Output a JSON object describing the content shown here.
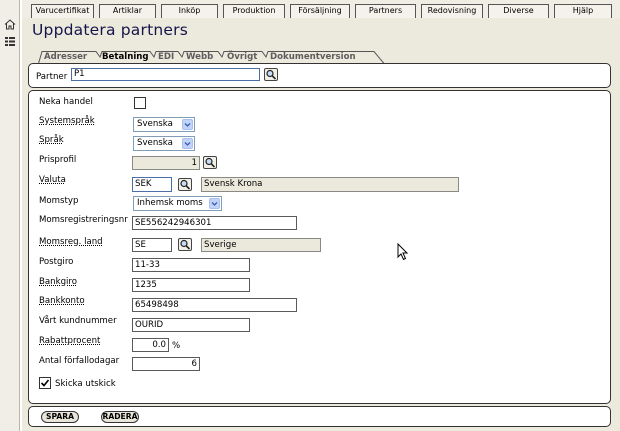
{
  "menu": {
    "items": [
      "Varucertifikat",
      "Artiklar",
      "Inköp",
      "Produktion",
      "Försäljning",
      "Partners",
      "Redovisning",
      "Diverse",
      "Hjälp"
    ]
  },
  "page": {
    "title": "Uppdatera partners"
  },
  "subtabs": {
    "items": [
      "Adresser",
      "Betalning",
      "EDI",
      "Webb",
      "Övrigt",
      "Dokumentversion"
    ],
    "active": "Betalning"
  },
  "partner": {
    "label": "Partner",
    "value": "P1"
  },
  "form": {
    "neka_handel": {
      "label": "Neka handel",
      "checked": false
    },
    "systemsprak": {
      "label": "Systemspråk",
      "value": "Svenska"
    },
    "sprak": {
      "label": "Språk",
      "value": "Svenska"
    },
    "prisprofil": {
      "label": "Prisprofil",
      "value": "1"
    },
    "valuta": {
      "label": "Valuta",
      "code": "SEK",
      "name": "Svensk Krona"
    },
    "momstyp": {
      "label": "Momstyp",
      "value": "Inhemsk moms"
    },
    "momsregistreringsnr": {
      "label": "Momsregistreringsnr",
      "value": "SE556242946301"
    },
    "momsreg_land": {
      "label": "Momsreg. land",
      "code": "SE",
      "name": "Sverige"
    },
    "postgiro": {
      "label": "Postgiro",
      "value": "11-33"
    },
    "bankgiro": {
      "label": "Bankgiro",
      "value": "1235"
    },
    "bankkonto": {
      "label": "Bankkonto",
      "value": "65498498"
    },
    "kundnummer": {
      "label": "Vårt kundnummer",
      "value": "OURID"
    },
    "rabattprocent": {
      "label": "Rabattprocent",
      "value": "0.0",
      "unit": "%"
    },
    "forfallodagar": {
      "label": "Antal förfallodagar",
      "value": "6"
    },
    "skicka_utskick": {
      "label": "Skicka utskick",
      "checked": true
    }
  },
  "actions": {
    "save": "SPARA",
    "delete": "RADERA"
  },
  "icons": {
    "home": "home-icon",
    "menu": "grid-menu-icon",
    "lookup": "magnifier-icon",
    "dropdown": "chevron-down-icon"
  },
  "colors": {
    "panel_bg": "#ece9dd",
    "title": "#15154a",
    "readonly_field": "#ebe8dc",
    "combo_border": "#7f9db9",
    "combo_button": "#c1d3fb"
  }
}
